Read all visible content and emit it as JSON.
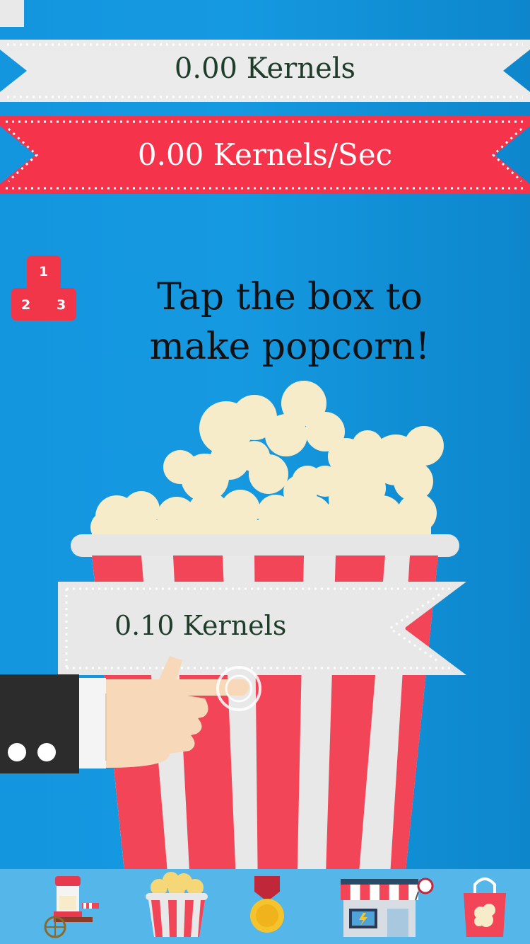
{
  "stats": {
    "kernels_label": "0.00 Kernels",
    "kernels_per_sec_label": "0.00 Kernels/Sec"
  },
  "instruction": {
    "line1": "Tap the box to",
    "line2": "make popcorn!"
  },
  "tap_popup": {
    "value_label": "0.10 Kernels"
  },
  "leaderboard": {
    "icon": "podium-icon",
    "ranks": [
      "1",
      "2",
      "3"
    ]
  },
  "bottom_tabs": [
    {
      "name": "popcorn-cart-icon"
    },
    {
      "name": "popcorn-box-icon"
    },
    {
      "name": "medal-icon"
    },
    {
      "name": "shop-icon"
    },
    {
      "name": "shopping-bag-icon"
    }
  ],
  "colors": {
    "background": "#1496df",
    "banner_white": "#ebebeb",
    "banner_red": "#f5334a",
    "popcorn": "#f7ecc9",
    "box_red": "#f24558",
    "box_white": "#e8e8e8",
    "nav_bar": "#4fb3e8"
  }
}
